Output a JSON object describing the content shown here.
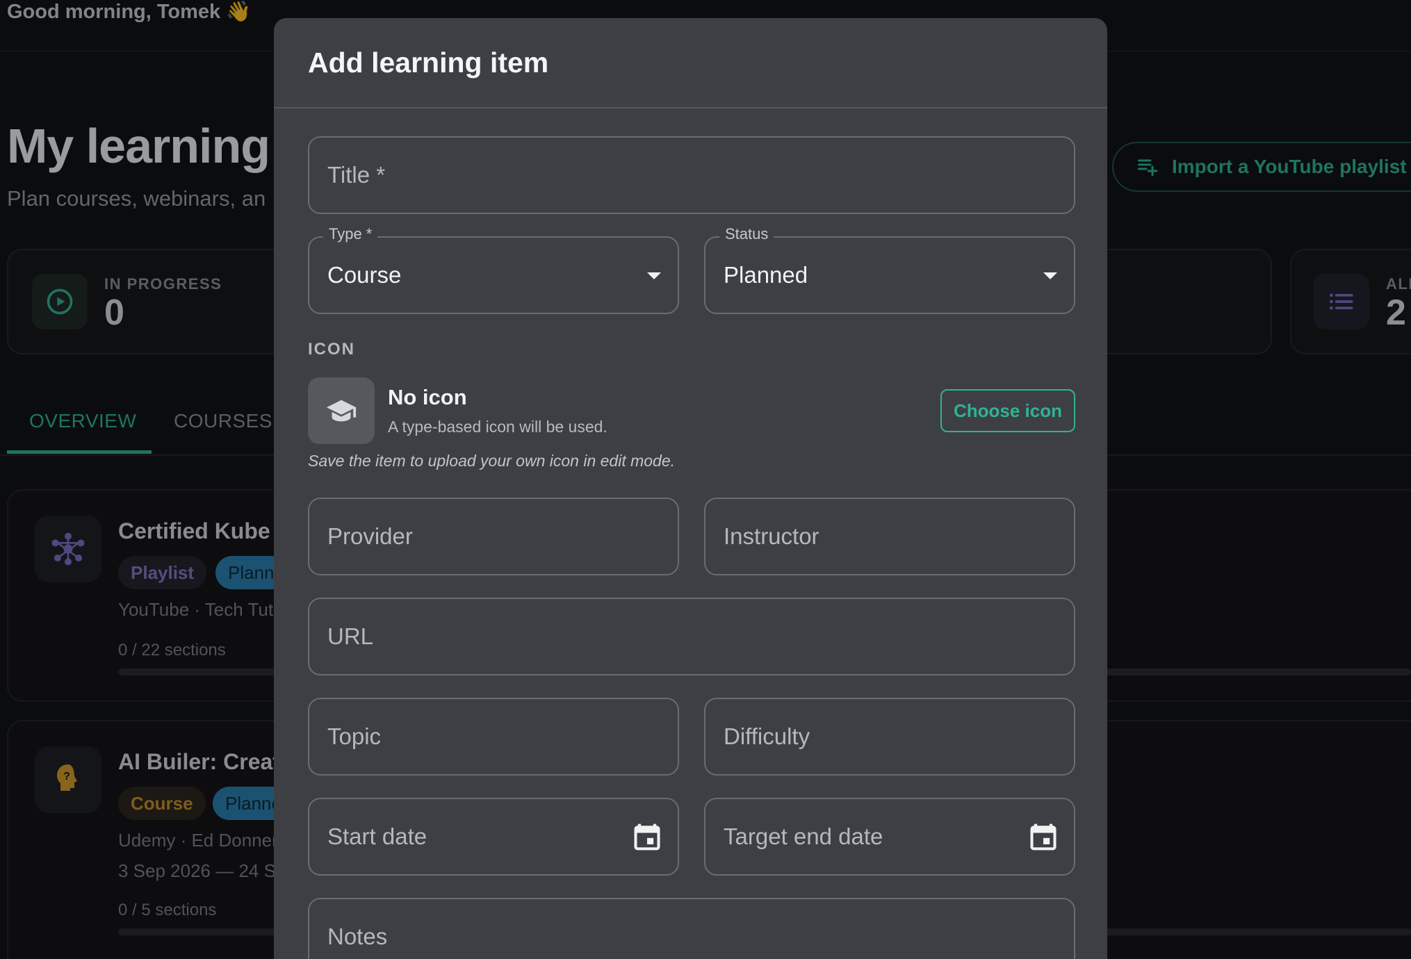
{
  "app": {
    "greeting": "Good morning, Tomek",
    "greeting_emoji": "👋",
    "page_title": "My learning",
    "page_subtitle": "Plan courses, webinars, an",
    "import_button_label": "Import a YouTube playlist",
    "stats": {
      "in_progress_label": "IN PROGRESS",
      "in_progress_value": "0",
      "all_label": "ALL",
      "all_value": "2"
    },
    "tabs": [
      "OVERVIEW",
      "COURSES"
    ],
    "items": [
      {
        "title": "Certified Kube",
        "type_chip": "Playlist",
        "status_chip": "Plann",
        "meta": "YouTube · Tech Tuto",
        "dates": "",
        "progress": "0 / 22 sections",
        "progress_fraction": 0
      },
      {
        "title": "AI Builer: Creat",
        "type_chip": "Course",
        "status_chip": "Planne",
        "meta": "Udemy · Ed Donner",
        "dates": "3 Sep 2026 — 24 S",
        "progress": "0 / 5 sections",
        "progress_fraction": 0
      }
    ]
  },
  "modal": {
    "title": "Add learning item",
    "fields": {
      "title_placeholder": "Title *",
      "type_legend": "Type *",
      "type_value": "Course",
      "status_legend": "Status",
      "status_value": "Planned",
      "provider_placeholder": "Provider",
      "instructor_placeholder": "Instructor",
      "url_placeholder": "URL",
      "topic_placeholder": "Topic",
      "difficulty_placeholder": "Difficulty",
      "start_date_placeholder": "Start date",
      "target_end_date_placeholder": "Target end date",
      "notes_placeholder": "Notes"
    },
    "icon_section": {
      "label": "ICON",
      "name": "No icon",
      "hint": "A type-based icon will be used.",
      "choose_button": "Choose icon",
      "note": "Save the item to upload your own icon in edit mode."
    }
  },
  "colors": {
    "accent": "#2fb394",
    "modal_bg": "#3e3f44",
    "page_bg": "#121316",
    "status_chip": "#2c7fae",
    "playlist_chip_text": "#8676c4",
    "course_chip_text": "#c38e2b"
  },
  "icons": [
    "wave-emoji",
    "playlist-add-icon",
    "play-circle-icon",
    "list-icon",
    "network-icon",
    "lightbulb-head-icon",
    "graduation-cap-icon",
    "calendar-icon",
    "dropdown-arrow-icon"
  ]
}
